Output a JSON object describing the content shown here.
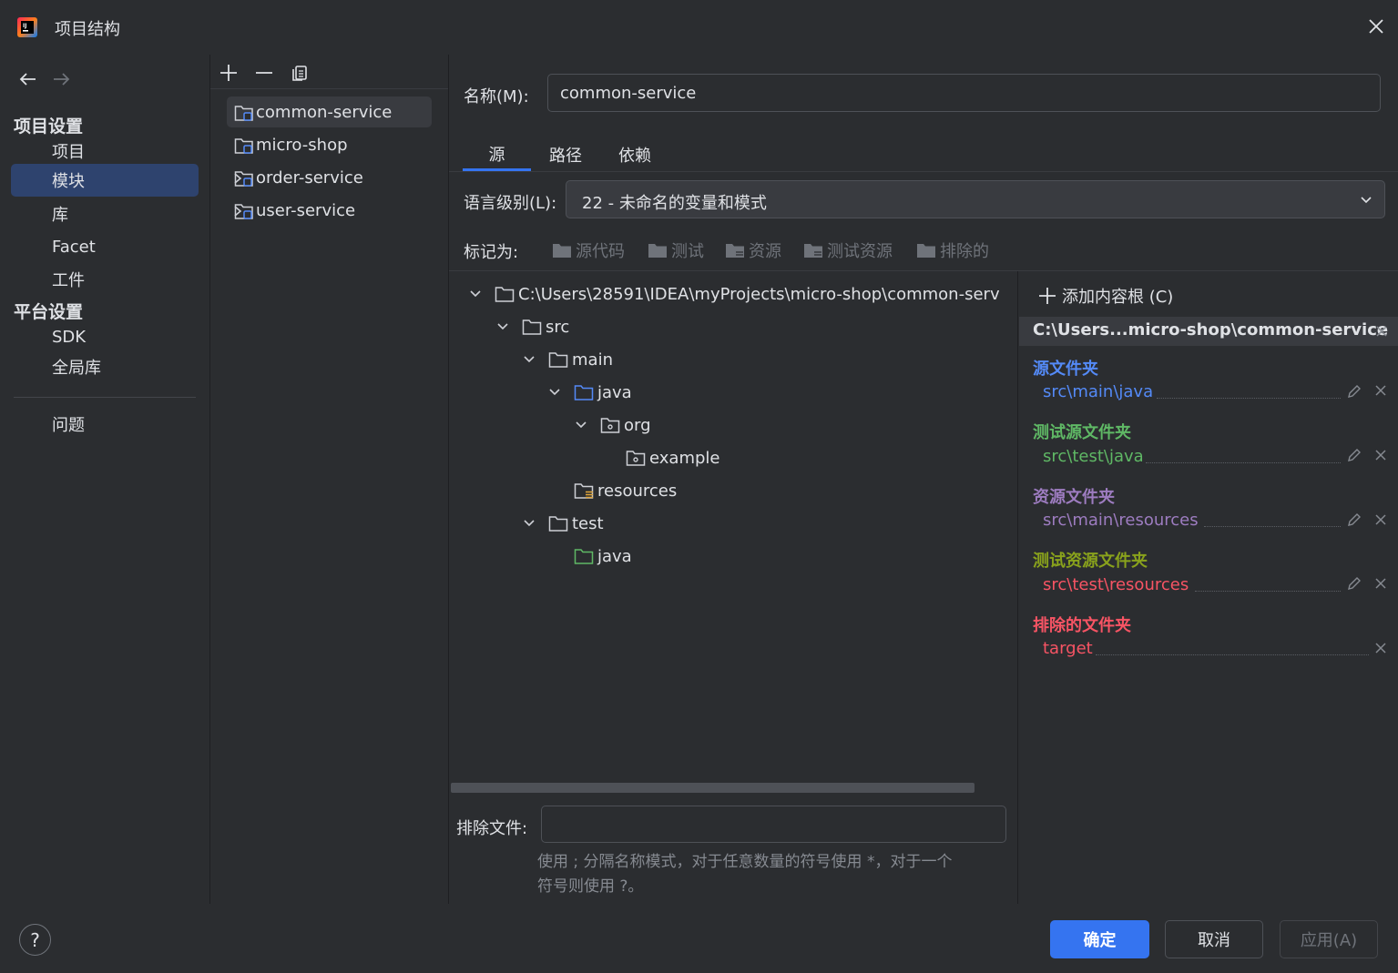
{
  "window": {
    "title": "项目结构"
  },
  "sidebar": {
    "project_settings_header": "项目设置",
    "project_items": [
      {
        "label": "项目"
      },
      {
        "label": "模块",
        "selected": true
      },
      {
        "label": "库"
      },
      {
        "label": "Facet"
      },
      {
        "label": "工件"
      }
    ],
    "platform_settings_header": "平台设置",
    "platform_items": [
      {
        "label": "SDK"
      },
      {
        "label": "全局库"
      }
    ],
    "problems_label": "问题"
  },
  "modules": [
    {
      "label": "common-service",
      "selected": true,
      "expandable": false
    },
    {
      "label": "micro-shop",
      "expandable": false
    },
    {
      "label": "order-service",
      "expandable": true
    },
    {
      "label": "user-service",
      "expandable": true
    }
  ],
  "main": {
    "name_label": "名称(M):",
    "name_value": "common-service",
    "tabs": [
      {
        "label": "源",
        "selected": true
      },
      {
        "label": "路径"
      },
      {
        "label": "依赖"
      }
    ],
    "language_level_label": "语言级别(L):",
    "language_level_value": "22 - 未命名的变量和模式",
    "mark_as_label": "标记为:",
    "mark_buttons": [
      {
        "label": "源代码"
      },
      {
        "label": "测试"
      },
      {
        "label": "资源"
      },
      {
        "label": "测试资源"
      },
      {
        "label": "排除的"
      }
    ],
    "tree": [
      {
        "label": "C:\\Users\\28591\\IDEA\\myProjects\\micro-shop\\common-serv",
        "depth": 0,
        "expanded": true,
        "icon": "folder-icon"
      },
      {
        "label": "src",
        "depth": 1,
        "expanded": true,
        "icon": "folder-icon"
      },
      {
        "label": "main",
        "depth": 2,
        "expanded": true,
        "icon": "folder-icon"
      },
      {
        "label": "java",
        "depth": 3,
        "expanded": true,
        "icon": "source-folder-icon"
      },
      {
        "label": "org",
        "depth": 4,
        "expanded": true,
        "icon": "package-icon"
      },
      {
        "label": "example",
        "depth": 5,
        "icon": "package-icon"
      },
      {
        "label": "resources",
        "depth": 3,
        "icon": "resources-folder-icon"
      },
      {
        "label": "test",
        "depth": 2,
        "expanded": true,
        "icon": "folder-icon"
      },
      {
        "label": "java",
        "depth": 3,
        "icon": "test-source-folder-icon"
      }
    ],
    "exclude_files_label": "排除文件:",
    "exclude_files_value": "",
    "hint_line1": "使用 ; 分隔名称模式，对于任意数量的符号使用 *，对于一个",
    "hint_line2": "符号则使用 ?。"
  },
  "content_root": {
    "add_label": "添加内容根 (C)",
    "root_path": "C:\\Users...micro-shop\\common-service",
    "categories": [
      {
        "title": "源文件夹",
        "path": "src\\main\\java",
        "color": "#548af7",
        "editable": true
      },
      {
        "title": "测试源文件夹",
        "path": "src\\test\\java",
        "color": "#5fb865",
        "editable": true
      },
      {
        "title": "资源文件夹",
        "path": "src\\main\\resources",
        "color": "#9d7cc0",
        "editable": true
      },
      {
        "title": "测试资源文件夹",
        "path": "src\\test\\resources",
        "color": "#89a21c",
        "editable": true
      },
      {
        "title": "排除的文件夹",
        "path": "target",
        "color": "#f75464",
        "editable": false
      }
    ]
  },
  "buttons": {
    "ok": "确定",
    "cancel": "取消",
    "apply": "应用(A)"
  },
  "colors": {
    "accent": "#3574f0",
    "bg": "#2b2d30"
  }
}
